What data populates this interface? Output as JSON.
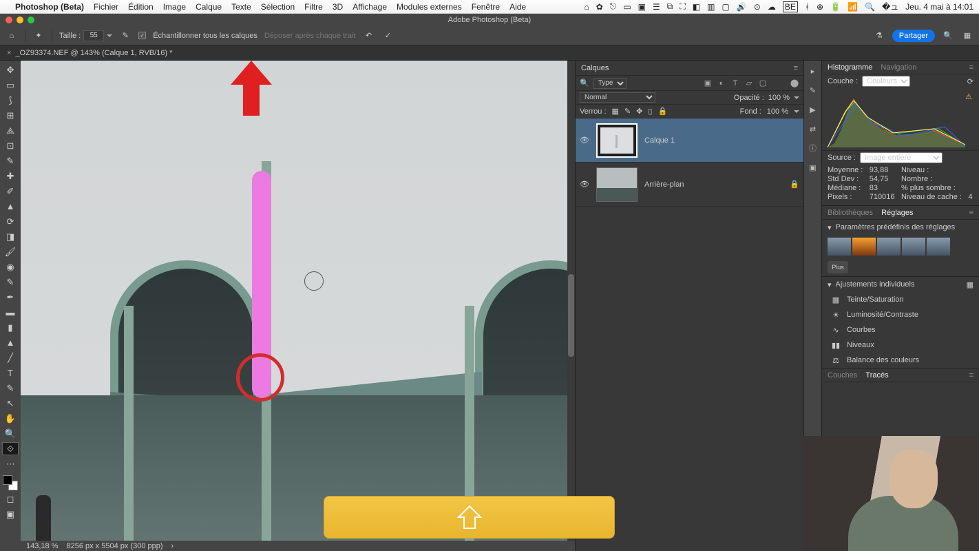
{
  "menubar": {
    "items": [
      "Photoshop (Beta)",
      "Fichier",
      "Édition",
      "Image",
      "Calque",
      "Texte",
      "Sélection",
      "Filtre",
      "3D",
      "Affichage",
      "Modules externes",
      "Fenêtre",
      "Aide"
    ],
    "clock": "Jeu. 4 mai à 14:01",
    "be": "BE"
  },
  "window": {
    "title": "Adobe Photoshop (Beta)"
  },
  "options": {
    "size_label": "Taille :",
    "size_value": "55",
    "sample_all": "Échantillonner tous les calques",
    "drop_after": "Déposer après chaque trait",
    "share": "Partager"
  },
  "doc": {
    "tab": "_OZ93374.NEF @ 143% (Calque 1, RVB/16) *"
  },
  "status": {
    "zoom": "143,18 %",
    "dims": "8256 px x 5504 px (300 ppp)",
    "chev": "›"
  },
  "layers": {
    "panel_title": "Calques",
    "filter_label": "Type",
    "blend": "Normal",
    "opacity_label": "Opacité :",
    "opacity": "100 %",
    "lock_label": "Verrou :",
    "fill_label": "Fond :",
    "fill": "100 %",
    "items": [
      {
        "name": "Calque 1"
      },
      {
        "name": "Arrière-plan"
      }
    ]
  },
  "histo": {
    "tab1": "Histogramme",
    "tab2": "Navigation",
    "couche_label": "Couche :",
    "couche": "Couleurs",
    "source_label": "Source :",
    "source": "Image entière",
    "stats": {
      "moy_l": "Moyenne :",
      "moy": "93,88",
      "std_l": "Std Dev :",
      "std": "54,75",
      "med_l": "Médiane :",
      "med": "83",
      "pix_l": "Pixels :",
      "pix": "710016",
      "niv_l": "Niveau :",
      "nb_l": "Nombre :",
      "som_l": "% plus sombre :",
      "cache_l": "Niveau de cache :",
      "cache": "4"
    }
  },
  "adjust": {
    "tab_bib": "Bibliothèques",
    "tab_reg": "Réglages",
    "presets_hdr": "Paramètres prédéfinis des réglages",
    "plus": "Plus",
    "indiv_hdr": "Ajustements individuels",
    "items": [
      "Teinte/Saturation",
      "Luminosité/Contraste",
      "Courbes",
      "Niveaux",
      "Balance des couleurs"
    ]
  },
  "paths": {
    "tab_couches": "Couches",
    "tab_traces": "Tracés"
  }
}
